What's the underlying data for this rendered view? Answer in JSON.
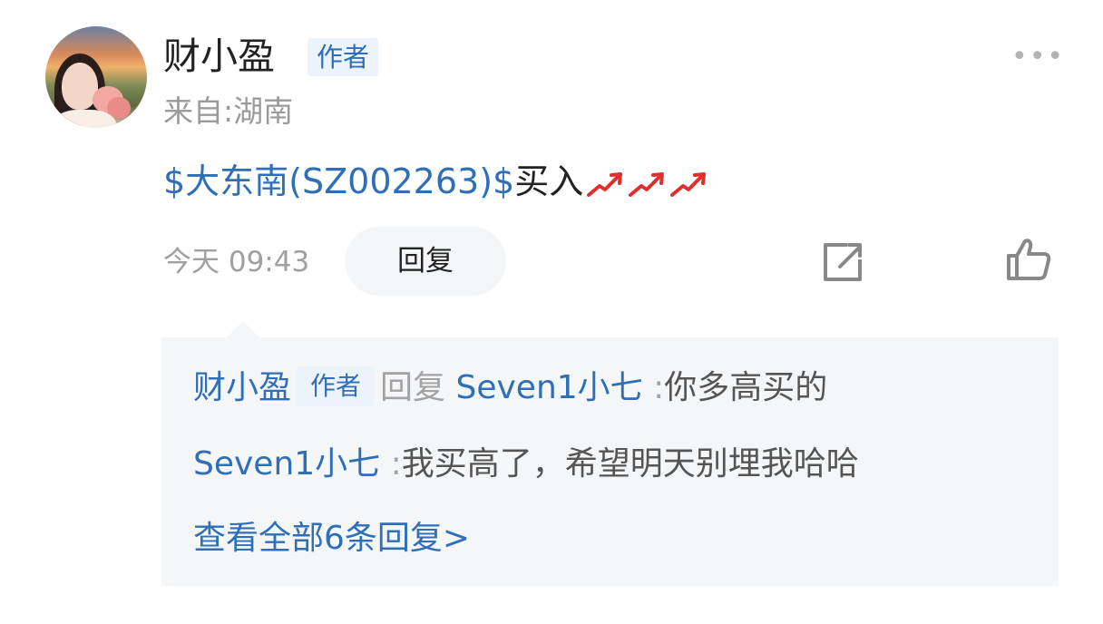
{
  "post": {
    "author": {
      "name": "财小盈",
      "badge": "作者",
      "origin": "来自:湖南"
    },
    "more_icon": "more-dots-icon",
    "content": {
      "stock_link": "$大东南(SZ002263)$",
      "text": "买入",
      "trend_icons": [
        "trend-up-icon",
        "trend-up-icon",
        "trend-up-icon"
      ]
    },
    "timestamp": "今天 09:43",
    "reply_button": "回复",
    "share_icon": "share-icon",
    "like_icon": "thumbs-up-icon"
  },
  "replies": {
    "items": [
      {
        "author": "财小盈",
        "badge": "作者",
        "reply_word": "回复",
        "target": "Seven1小七",
        "separator": ":",
        "text": "你多高买的"
      },
      {
        "author": "Seven1小七",
        "separator": ":",
        "text": "我买高了，希望明天别埋我哈哈"
      }
    ],
    "view_all": "查看全部6条回复>"
  },
  "colors": {
    "link": "#2f6fb7",
    "badge_bg": "#edf3fb",
    "reply_bg": "#f5f6f8",
    "trend": "#e0302d"
  }
}
